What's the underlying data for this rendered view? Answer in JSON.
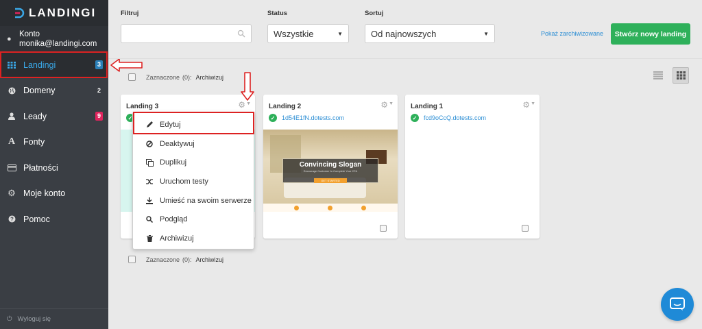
{
  "brand": {
    "name": "LANDINGI"
  },
  "account": {
    "label": "Konto",
    "email": "monika@landingi.com"
  },
  "nav": [
    {
      "label": "Landingi",
      "icon": "grid-icon",
      "badge": "3",
      "badge_color": "#2a7fb8",
      "active": true
    },
    {
      "label": "Domeny",
      "icon": "globe-icon",
      "badge": "2",
      "badge_color": "#3a3e44"
    },
    {
      "label": "Leady",
      "icon": "user-icon",
      "badge": "9",
      "badge_color": "#e0245e"
    },
    {
      "label": "Fonty",
      "icon": "font-icon"
    },
    {
      "label": "Płatności",
      "icon": "credit-card-icon"
    },
    {
      "label": "Moje konto",
      "icon": "gear-icon"
    },
    {
      "label": "Pomoc",
      "icon": "question-icon"
    }
  ],
  "logout": {
    "label": "Wyloguj się"
  },
  "filters": {
    "filter_label": "Filtruj",
    "filter_value": "",
    "status_label": "Status",
    "status_value": "Wszystkie",
    "sort_label": "Sortuj",
    "sort_value": "Od najnowszych"
  },
  "actions": {
    "archived_link": "Pokaż zarchiwizowane",
    "create_button": "Stwórz nowy landing"
  },
  "selection": {
    "label": "Zaznaczone",
    "count": "(0):",
    "archive": "Archiwizuj"
  },
  "cards": [
    {
      "title": "Landing 3",
      "domain": ""
    },
    {
      "title": "Landing 2",
      "domain": "1d54E1fN.dotests.com",
      "preview_slogan": "Convincing Slogan",
      "preview_sub": "Encourage Customer to Complete Your CTA",
      "preview_btn": "GET STARTED"
    },
    {
      "title": "Landing 1",
      "domain": "fcd9oCcQ.dotests.com"
    }
  ],
  "menu": [
    {
      "label": "Edytuj",
      "icon": "pencil-icon"
    },
    {
      "label": "Deaktywuj",
      "icon": "ban-icon"
    },
    {
      "label": "Duplikuj",
      "icon": "copy-icon"
    },
    {
      "label": "Uruchom testy",
      "icon": "shuffle-icon"
    },
    {
      "label": "Umieść na swoim serwerze",
      "icon": "download-icon"
    },
    {
      "label": "Podgląd",
      "icon": "search-icon"
    },
    {
      "label": "Archiwizuj",
      "icon": "trash-icon"
    }
  ],
  "colors": {
    "accent": "#3aa8e8",
    "sidebar": "#3a3e44",
    "green": "#2eb05a",
    "annotation": "#dd2222",
    "chat": "#1f8ad7"
  }
}
